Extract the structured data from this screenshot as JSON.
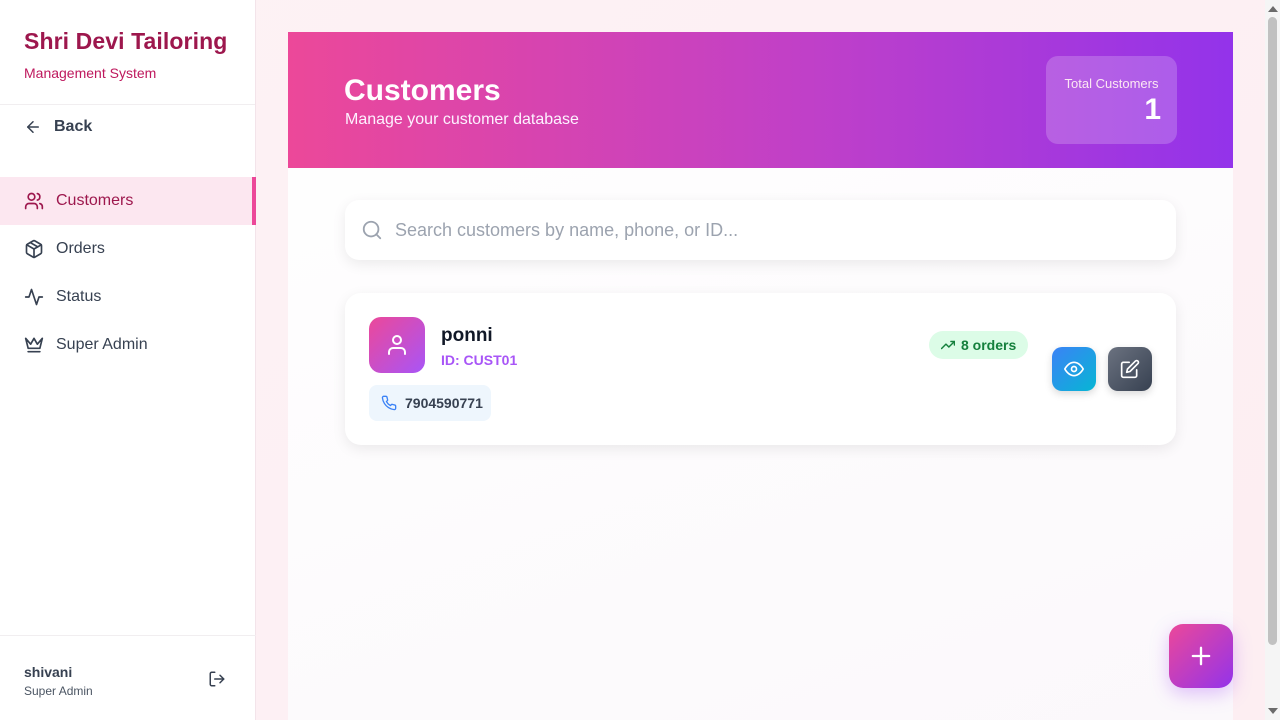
{
  "sidebar": {
    "brand_title": "Shri Devi Tailoring",
    "brand_subtitle": "Management System",
    "back_label": "Back",
    "items": [
      {
        "label": "Customers",
        "icon": "users-icon",
        "active": true
      },
      {
        "label": "Orders",
        "icon": "package-icon",
        "active": false
      },
      {
        "label": "Status",
        "icon": "activity-icon",
        "active": false
      },
      {
        "label": "Super Admin",
        "icon": "crown-icon",
        "active": false
      }
    ],
    "user": {
      "name": "shivani",
      "role": "Super Admin"
    }
  },
  "header": {
    "title": "Customers",
    "subtitle": "Manage your customer database",
    "stat_label": "Total Customers",
    "stat_value": "1"
  },
  "search": {
    "placeholder": "Search customers by name, phone, or ID...",
    "value": ""
  },
  "customers": [
    {
      "name": "ponni",
      "id_label": "ID: CUST01",
      "phone": "7904590771",
      "orders": "8 orders"
    }
  ],
  "colors": {
    "brand": "#9d174d",
    "accent_pink": "#ec4899",
    "accent_purple": "#9333ea",
    "success": "#15803d"
  }
}
